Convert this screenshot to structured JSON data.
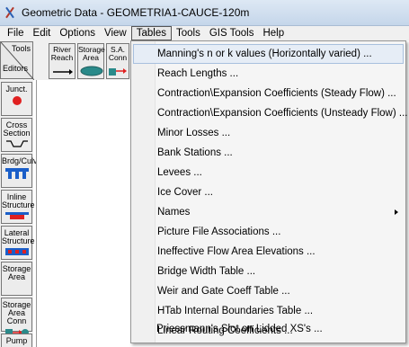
{
  "window": {
    "title": "Geometric Data - GEOMETRIA1-CAUCE-120m"
  },
  "menubar": [
    {
      "label": "File"
    },
    {
      "label": "Edit"
    },
    {
      "label": "Options"
    },
    {
      "label": "View"
    },
    {
      "label": "Tables"
    },
    {
      "label": "Tools"
    },
    {
      "label": "GIS Tools"
    },
    {
      "label": "Help"
    }
  ],
  "toolbar": {
    "editors": {
      "top_label": "Tools",
      "bottom_label": "Editors"
    },
    "buttons": [
      {
        "label": "River Reach"
      },
      {
        "label": "Storage Area"
      },
      {
        "label": "S.A. Conn"
      }
    ]
  },
  "side_tools": [
    {
      "label": "Junct."
    },
    {
      "label": "Cross Section"
    },
    {
      "label": "Brdg/Culv"
    },
    {
      "label": "Inline Structure"
    },
    {
      "label": "Lateral Structure"
    },
    {
      "label": "Storage Area"
    },
    {
      "label": "Storage Area Conn"
    },
    {
      "label": "Pump"
    }
  ],
  "tables_menu": [
    {
      "label": "Manning's n or k values (Horizontally varied) ..."
    },
    {
      "label": "Reach Lengths ..."
    },
    {
      "label": "Contraction\\Expansion Coefficients (Steady Flow) ..."
    },
    {
      "label": "Contraction\\Expansion Coefficients (Unsteady Flow) ..."
    },
    {
      "label": "Minor Losses ..."
    },
    {
      "label": "Bank Stations ..."
    },
    {
      "label": "Levees ..."
    },
    {
      "label": "Ice Cover ..."
    },
    {
      "label": "Names"
    },
    {
      "label": "Picture File Associations ..."
    },
    {
      "label": "Ineffective Flow Area Elevations ..."
    },
    {
      "label": "Bridge Width Table ..."
    },
    {
      "label": "Weir and Gate Coeff Table ..."
    },
    {
      "label": "HTab Internal Boundaries Table ..."
    },
    {
      "label": "Linear Routing Coefficients ..."
    },
    {
      "label": "Priessmann's Slot on Lidded XS's ..."
    }
  ],
  "colors": {
    "hover_bg": "#e6edf6",
    "hover_border": "#a8c0de",
    "accent_teal": "#2a8a8a",
    "accent_red": "#e02020",
    "accent_blue": "#1a5ec8"
  }
}
